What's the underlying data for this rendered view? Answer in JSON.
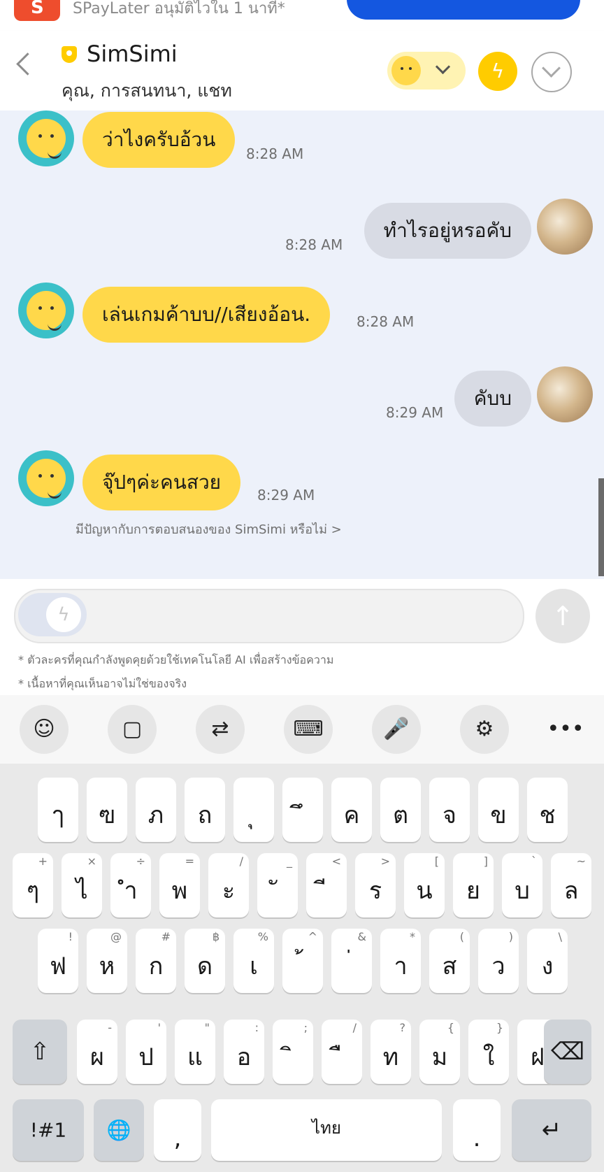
{
  "banner": {
    "text": "SPayLater อนุมัติไวใน 1 นาที*",
    "logo": "S"
  },
  "header": {
    "title": "SimSimi",
    "subtitle": "คุณ, การสนทนา, แชท",
    "icons": {
      "back": "chevron-left-icon",
      "verified": "shield-icon",
      "boost": "lightning-icon",
      "collapse": "chevron-down-circle-icon"
    }
  },
  "chat": {
    "messages": [
      {
        "sender": "bot",
        "text": "ว่าไงครับอ้วน",
        "time": "8:28 AM"
      },
      {
        "sender": "user",
        "text": "ทำไรอยู่หรอคับ",
        "time": "8:28 AM"
      },
      {
        "sender": "bot",
        "text": "เล่นเกมค้าบบ//เสียงอ้อน.",
        "time": "8:28 AM"
      },
      {
        "sender": "user",
        "text": "คับบ",
        "time": "8:29 AM"
      },
      {
        "sender": "bot",
        "text": "จุ๊ปๆค่ะคนสวย",
        "time": "8:29 AM"
      }
    ],
    "report_link": "มีปัญหากับการตอบสนองของ SimSimi หรือไม่ >"
  },
  "input": {
    "placeholder": "",
    "send_icon": "arrow-up-icon",
    "disclaimer_1": "* ตัวละครที่คุณกำลังพูดคุยด้วยใช้เทคโนโลยี AI เพื่อสร้างข้อความ",
    "disclaimer_2": "* เนื้อหาที่คุณเห็นอาจไม่ใช่ของจริง"
  },
  "keyboard_toolbar": [
    {
      "icon": "emoji-icon",
      "glyph": "☺"
    },
    {
      "icon": "clipboard-icon",
      "glyph": "▢"
    },
    {
      "icon": "translate-icon",
      "glyph": "⇄"
    },
    {
      "icon": "keyboard-mode-icon",
      "glyph": "⌨"
    },
    {
      "icon": "microphone-icon",
      "glyph": "🎤"
    },
    {
      "icon": "settings-icon",
      "glyph": "⚙"
    },
    {
      "icon": "more-icon",
      "glyph": "•••"
    }
  ],
  "keyboard": {
    "row1": [
      {
        "k": "ๅ",
        "s": ""
      },
      {
        "k": "ฃ",
        "s": ""
      },
      {
        "k": "ภ",
        "s": ""
      },
      {
        "k": "ถ",
        "s": ""
      },
      {
        "k": "ุ",
        "s": ""
      },
      {
        "k": "ึ",
        "s": ""
      },
      {
        "k": "ค",
        "s": ""
      },
      {
        "k": "ต",
        "s": ""
      },
      {
        "k": "จ",
        "s": ""
      },
      {
        "k": "ข",
        "s": ""
      },
      {
        "k": "ช",
        "s": ""
      }
    ],
    "row2": [
      {
        "k": "ๆ",
        "s": "+"
      },
      {
        "k": "ไ",
        "s": "×"
      },
      {
        "k": "ำ",
        "s": "÷"
      },
      {
        "k": "พ",
        "s": "="
      },
      {
        "k": "ะ",
        "s": "/"
      },
      {
        "k": "ั",
        "s": "_"
      },
      {
        "k": "ี",
        "s": "<"
      },
      {
        "k": "ร",
        "s": ">"
      },
      {
        "k": "น",
        "s": "["
      },
      {
        "k": "ย",
        "s": "]"
      },
      {
        "k": "บ",
        "s": "`"
      },
      {
        "k": "ล",
        "s": "~"
      }
    ],
    "row3": [
      {
        "k": "ฟ",
        "s": "!"
      },
      {
        "k": "ห",
        "s": "@"
      },
      {
        "k": "ก",
        "s": "#"
      },
      {
        "k": "ด",
        "s": "฿"
      },
      {
        "k": "เ",
        "s": "%"
      },
      {
        "k": "้",
        "s": "^"
      },
      {
        "k": "่",
        "s": "&"
      },
      {
        "k": "า",
        "s": "*"
      },
      {
        "k": "ส",
        "s": "("
      },
      {
        "k": "ว",
        "s": ")"
      },
      {
        "k": "ง",
        "s": "\\"
      }
    ],
    "row4": [
      {
        "k": "ผ",
        "s": "-"
      },
      {
        "k": "ป",
        "s": "'"
      },
      {
        "k": "แ",
        "s": "\""
      },
      {
        "k": "อ",
        "s": ":"
      },
      {
        "k": "ิ",
        "s": ";"
      },
      {
        "k": "ื",
        "s": "/"
      },
      {
        "k": "ท",
        "s": "?"
      },
      {
        "k": "ม",
        "s": "{"
      },
      {
        "k": "ใ",
        "s": "}"
      },
      {
        "k": "ฝ",
        "s": "|"
      }
    ],
    "shift": "⇧",
    "backspace": "⌫",
    "symbols": "!#1",
    "globe": "🌐",
    "comma": ",",
    "space": "ไทย",
    "period": ".",
    "enter": "↵"
  }
}
